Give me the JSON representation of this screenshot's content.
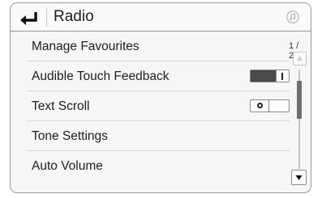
{
  "header": {
    "back_icon": "back-arrow-icon",
    "title": "Radio",
    "media_icon": "music-note-icon"
  },
  "list": {
    "items": [
      {
        "label": "Manage Favourites",
        "control": "none"
      },
      {
        "label": "Audible Touch Feedback",
        "control": "toggle",
        "state": "on"
      },
      {
        "label": "Text Scroll",
        "control": "toggle",
        "state": "off"
      },
      {
        "label": "Tone Settings",
        "control": "none"
      },
      {
        "label": "Auto Volume",
        "control": "none"
      }
    ]
  },
  "scroll": {
    "page_indicator": "1 / 2",
    "current_page": 1,
    "total_pages": 2,
    "up_icon": "triangle-up-icon",
    "down_icon": "triangle-down-icon",
    "up_enabled": false,
    "down_enabled": true
  },
  "colors": {
    "frame": "#9a9a9a",
    "background": "#f6f6f6",
    "toggle_on_fill": "#4a4a4a",
    "text": "#1e1e1e"
  }
}
